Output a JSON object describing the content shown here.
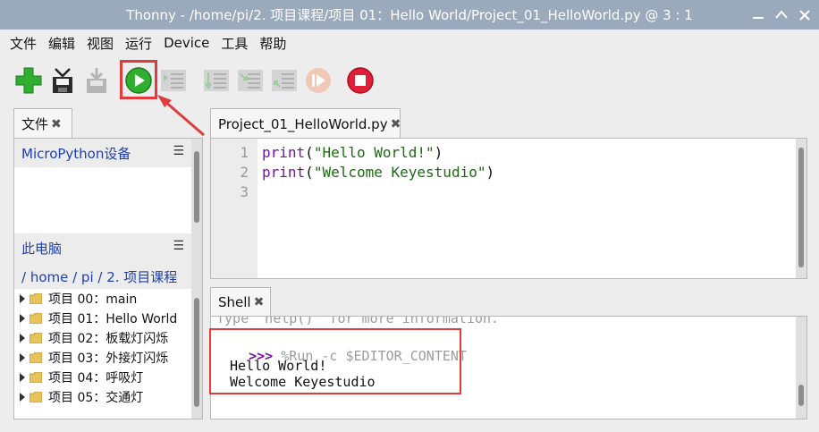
{
  "window": {
    "title": "Thonny  -  /home/pi/2. 项目课程/项目 01：Hello World/Project_01_HelloWorld.py  @  3 : 1"
  },
  "menu": [
    "文件",
    "编辑",
    "视图",
    "运行",
    "Device",
    "工具",
    "帮助"
  ],
  "toolbar": [
    "new-file-icon",
    "save-icon",
    "download-icon",
    "run-icon",
    "debug-icon",
    "step-over-icon",
    "step-into-icon",
    "step-out-icon",
    "resume-icon",
    "stop-icon"
  ],
  "files": {
    "tab_label": "文件",
    "device_header": "MicroPython设备",
    "computer_header": "此电脑",
    "path": "/ home / pi / 2. 项目课程",
    "items": [
      "项目 00：main",
      "项目 01：Hello World",
      "项目 02：板载灯闪烁",
      "项目 03：外接灯闪烁",
      "项目 04：呼吸灯",
      "项目 05：交通灯"
    ]
  },
  "editor": {
    "tab_label": "Project_01_HelloWorld.py",
    "line_numbers": [
      "1",
      "2",
      "3"
    ],
    "lines": [
      {
        "fn": "print",
        "open": "(",
        "str": "\"Hello World!\"",
        "close": ")"
      },
      {
        "fn": "print",
        "open": "(",
        "str": "\"Welcome Keyestudio\"",
        "close": ")"
      }
    ]
  },
  "shell": {
    "tab_label": "Shell",
    "partial_line": "Type \"help()\" for more information.",
    "prompt": ">>>",
    "run_command": "%Run -c $EDITOR_CONTENT",
    "output": [
      "Hello World!",
      "Welcome Keyestudio"
    ]
  },
  "colors": {
    "accent_red": "#e03c3c",
    "keyword": "#7a0fa8",
    "string": "#1d6a12"
  }
}
